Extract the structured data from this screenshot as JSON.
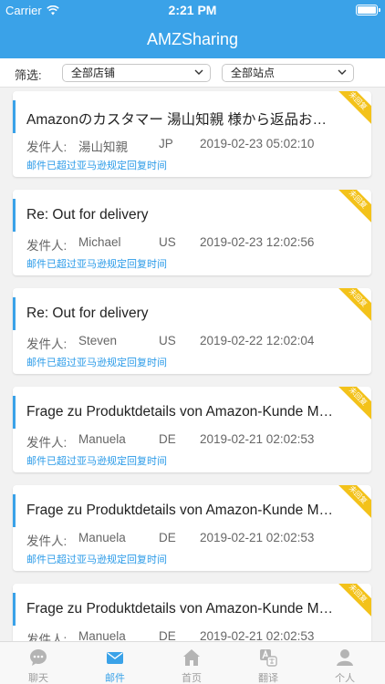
{
  "status_bar": {
    "carrier": "Carrier",
    "time": "2:21 PM"
  },
  "nav": {
    "title": "AMZSharing"
  },
  "filter": {
    "label": "筛选:",
    "store_select": "全部店铺",
    "site_select": "全部站点"
  },
  "sender_label": "发件人:",
  "overdue_text": "邮件已超过亚马逊规定回复时间",
  "ribbon_text": "未回复",
  "emails": [
    {
      "subject": "Amazonのカスタマー 湯山知親 様から返品お問い合わせ",
      "sender": "湯山知親",
      "country": "JP",
      "date": "2019-02-23 05:02:10"
    },
    {
      "subject": "Re: Out for delivery",
      "sender": "Michael",
      "country": "US",
      "date": "2019-02-23 12:02:56"
    },
    {
      "subject": "Re: Out for delivery",
      "sender": "Steven",
      "country": "US",
      "date": "2019-02-22 12:02:04"
    },
    {
      "subject": "Frage zu Produktdetails von Amazon-Kunde Manuela",
      "sender": "Manuela",
      "country": "DE",
      "date": "2019-02-21 02:02:53"
    },
    {
      "subject": "Frage zu Produktdetails von Amazon-Kunde Manuela",
      "sender": "Manuela",
      "country": "DE",
      "date": "2019-02-21 02:02:53"
    },
    {
      "subject": "Frage zu Produktdetails von Amazon-Kunde Manuela",
      "sender": "Manuela",
      "country": "DE",
      "date": "2019-02-21 02:02:53"
    }
  ],
  "tabs": [
    {
      "label": "聊天",
      "icon": "chat-icon",
      "active": false
    },
    {
      "label": "邮件",
      "icon": "mail-icon",
      "active": true
    },
    {
      "label": "首页",
      "icon": "home-icon",
      "active": false
    },
    {
      "label": "翻译",
      "icon": "translate-icon",
      "active": false
    },
    {
      "label": "个人",
      "icon": "person-icon",
      "active": false
    }
  ],
  "colors": {
    "primary": "#3aa2e8",
    "ribbon": "#f3c21a",
    "overdue": "#2b9be8"
  }
}
